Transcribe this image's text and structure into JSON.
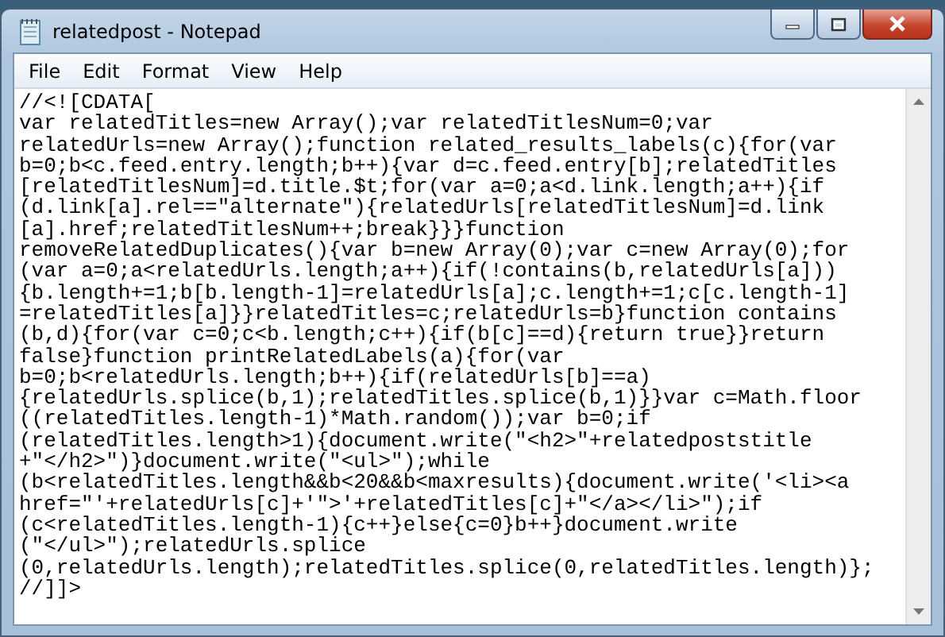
{
  "window": {
    "title": "relatedpost - Notepad"
  },
  "menu": [
    "File",
    "Edit",
    "Format",
    "View",
    "Help"
  ],
  "editor": {
    "lines": [
      "//<![CDATA[",
      "var relatedTitles=new Array();var relatedTitlesNum=0;var",
      "relatedUrls=new Array();function related_results_labels(c){for(var",
      "b=0;b<c.feed.entry.length;b++){var d=c.feed.entry[b];relatedTitles",
      "[relatedTitlesNum]=d.title.$t;for(var a=0;a<d.link.length;a++){if",
      "(d.link[a].rel==\"alternate\"){relatedUrls[relatedTitlesNum]=d.link",
      "[a].href;relatedTitlesNum++;break}}}function",
      "removeRelatedDuplicates(){var b=new Array(0);var c=new Array(0);for",
      "(var a=0;a<relatedUrls.length;a++){if(!contains(b,relatedUrls[a]))",
      "{b.length+=1;b[b.length-1]=relatedUrls[a];c.length+=1;c[c.length-1]",
      "=relatedTitles[a]}}relatedTitles=c;relatedUrls=b}function contains",
      "(b,d){for(var c=0;c<b.length;c++){if(b[c]==d){return true}}return",
      "false}function printRelatedLabels(a){for(var",
      "b=0;b<relatedUrls.length;b++){if(relatedUrls[b]==a)",
      "{relatedUrls.splice(b,1);relatedTitles.splice(b,1)}}var c=Math.floor",
      "((relatedTitles.length-1)*Math.random());var b=0;if",
      "(relatedTitles.length>1){document.write(\"<h2>\"+relatedpoststitle",
      "+\"</h2>\")}document.write(\"<ul>\");while",
      "(b<relatedTitles.length&&b<20&&b<maxresults){document.write('<li><a",
      "href=\"'+relatedUrls[c]+'\">'+relatedTitles[c]+\"</a></li>\");if",
      "(c<relatedTitles.length-1){c++}else{c=0}b++}document.write",
      "(\"</ul>\");relatedUrls.splice",
      "(0,relatedUrls.length);relatedTitles.splice(0,relatedTitles.length)};",
      "//]]>"
    ]
  }
}
